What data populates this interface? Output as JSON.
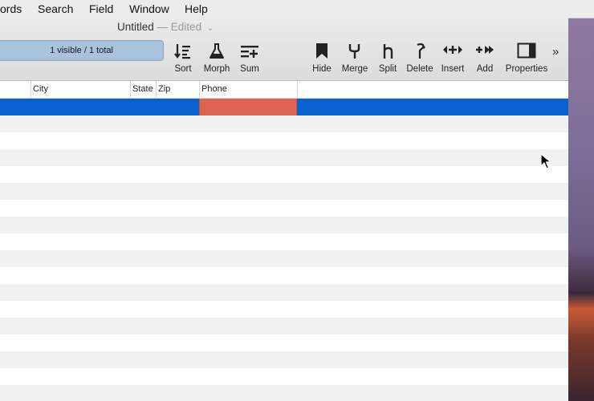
{
  "menubar": {
    "items": [
      {
        "label": "ords"
      },
      {
        "label": "Search"
      },
      {
        "label": "Field"
      },
      {
        "label": "Window"
      },
      {
        "label": "Help"
      }
    ]
  },
  "window": {
    "title": "Untitled",
    "edited": "— Edited"
  },
  "filter": {
    "text": "1 visible / 1 total"
  },
  "toolbar": {
    "sort": "Sort",
    "morph": "Morph",
    "sum": "Sum",
    "hide": "Hide",
    "merge": "Merge",
    "split": "Split",
    "delete": "Delete",
    "insert": "Insert",
    "add": "Add",
    "properties": "Properties",
    "overflow": "»"
  },
  "columns": {
    "city": "City",
    "state": "State",
    "zip": "Zip",
    "phone": "Phone"
  },
  "table": {
    "selected_row": 1,
    "row_count": 18
  },
  "colors": {
    "selection": "#0b61d0",
    "active_cell": "#dc6450",
    "filter_field": "#a9c3dd"
  }
}
